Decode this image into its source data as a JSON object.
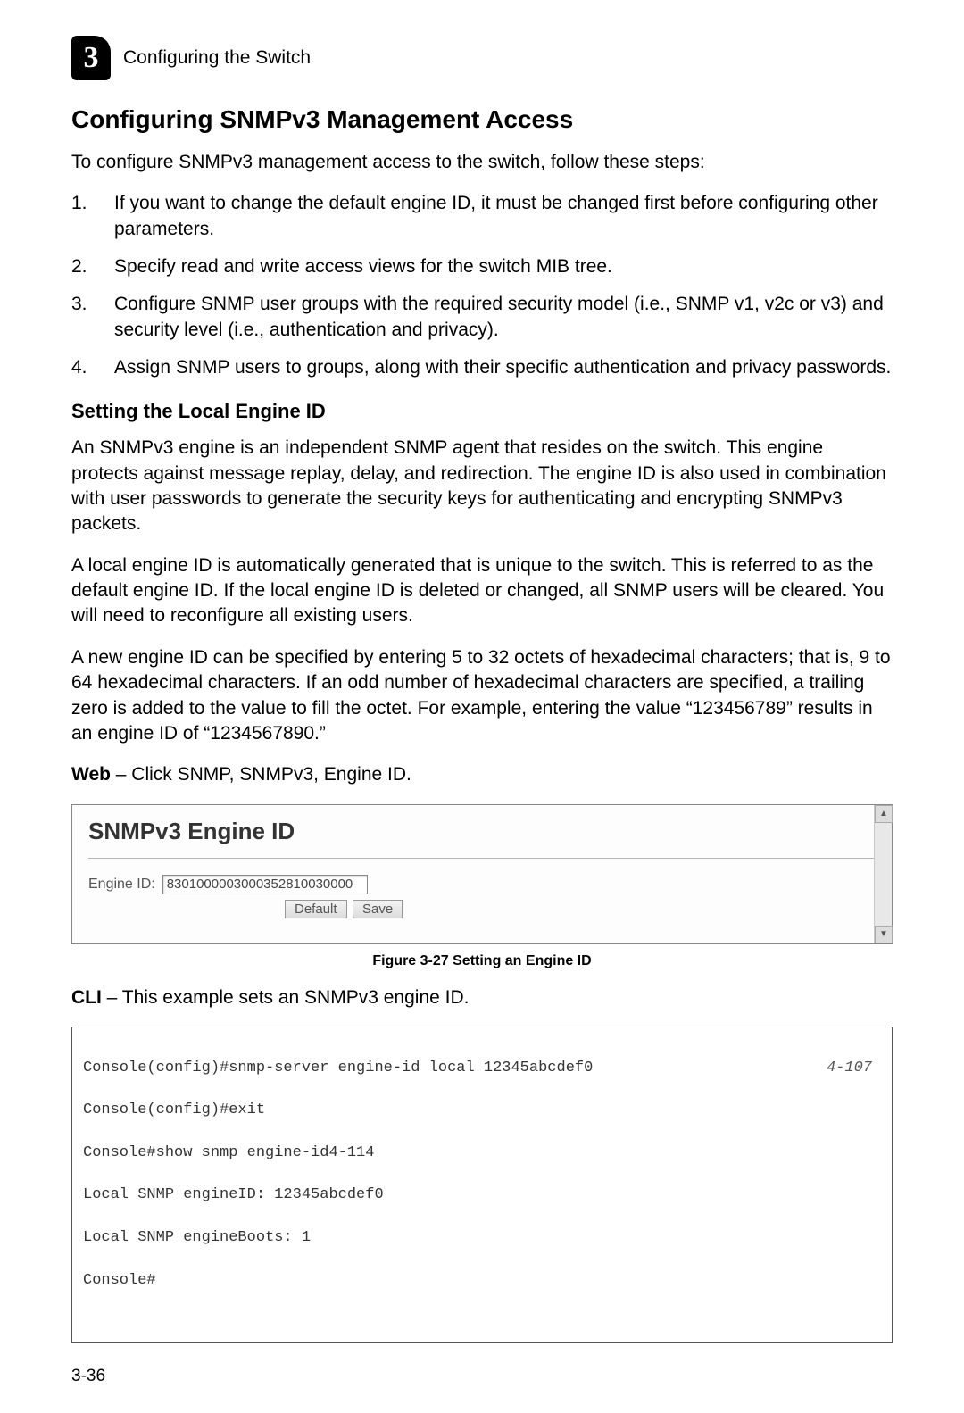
{
  "header": {
    "chapter_number": "3",
    "chapter_title": "Configuring the Switch"
  },
  "section_heading": "Configuring SNMPv3 Management Access",
  "intro_text": "To configure SNMPv3 management access to the switch, follow these steps:",
  "steps": [
    {
      "num": "1.",
      "text": "If you want to change the default engine ID, it must be changed first before configuring other parameters."
    },
    {
      "num": "2.",
      "text": "Specify read and write access views for the switch MIB tree."
    },
    {
      "num": "3.",
      "text": "Configure SNMP user groups with the required security model (i.e., SNMP v1, v2c or v3) and security level (i.e., authentication and privacy)."
    },
    {
      "num": "4.",
      "text": "Assign SNMP users to groups, along with their specific authentication and privacy passwords."
    }
  ],
  "subheading": "Setting the Local Engine ID",
  "para1": "An SNMPv3 engine is an independent SNMP agent that resides on the switch. This engine protects against message replay, delay, and redirection. The engine ID is also used in combination with user passwords to generate the security keys for authenticating and encrypting SNMPv3 packets.",
  "para2": "A local engine ID is automatically generated that is unique to the switch. This is referred to as the default engine ID. If the local engine ID is deleted or changed, all SNMP users will be cleared. You will need to reconfigure all existing users.",
  "para3": "A new engine ID can be specified by entering 5 to 32 octets of hexadecimal characters; that is, 9 to 64 hexadecimal characters. If an odd number of hexadecimal characters are specified, a trailing zero is added to the value to fill the octet. For example, entering the value “123456789” results in an engine ID of “1234567890.”",
  "web_label": "Web",
  "web_text": " – Click SNMP, SNMPv3, Engine ID.",
  "screenshot": {
    "panel_title": "SNMPv3 Engine ID",
    "engine_label": "Engine ID:",
    "engine_value": "8301000003000352810030000",
    "default_btn": "Default",
    "save_btn": "Save",
    "scroll_up": "▲",
    "scroll_down": "▼"
  },
  "figure_caption": "Figure 3-27  Setting an Engine ID",
  "cli_label": "CLI",
  "cli_text": " – This example sets an SNMPv3 engine ID.",
  "cli": {
    "line1_cmd": "Console(config)#snmp-server engine-id local 12345abcdef0",
    "line1_ref": "4-107",
    "line2": "Console(config)#exit",
    "line3": "Console#show snmp engine-id4-114",
    "line4": "Local SNMP engineID: 12345abcdef0",
    "line5": "Local SNMP engineBoots: 1",
    "line6": "Console#"
  },
  "page_number": "3-36"
}
